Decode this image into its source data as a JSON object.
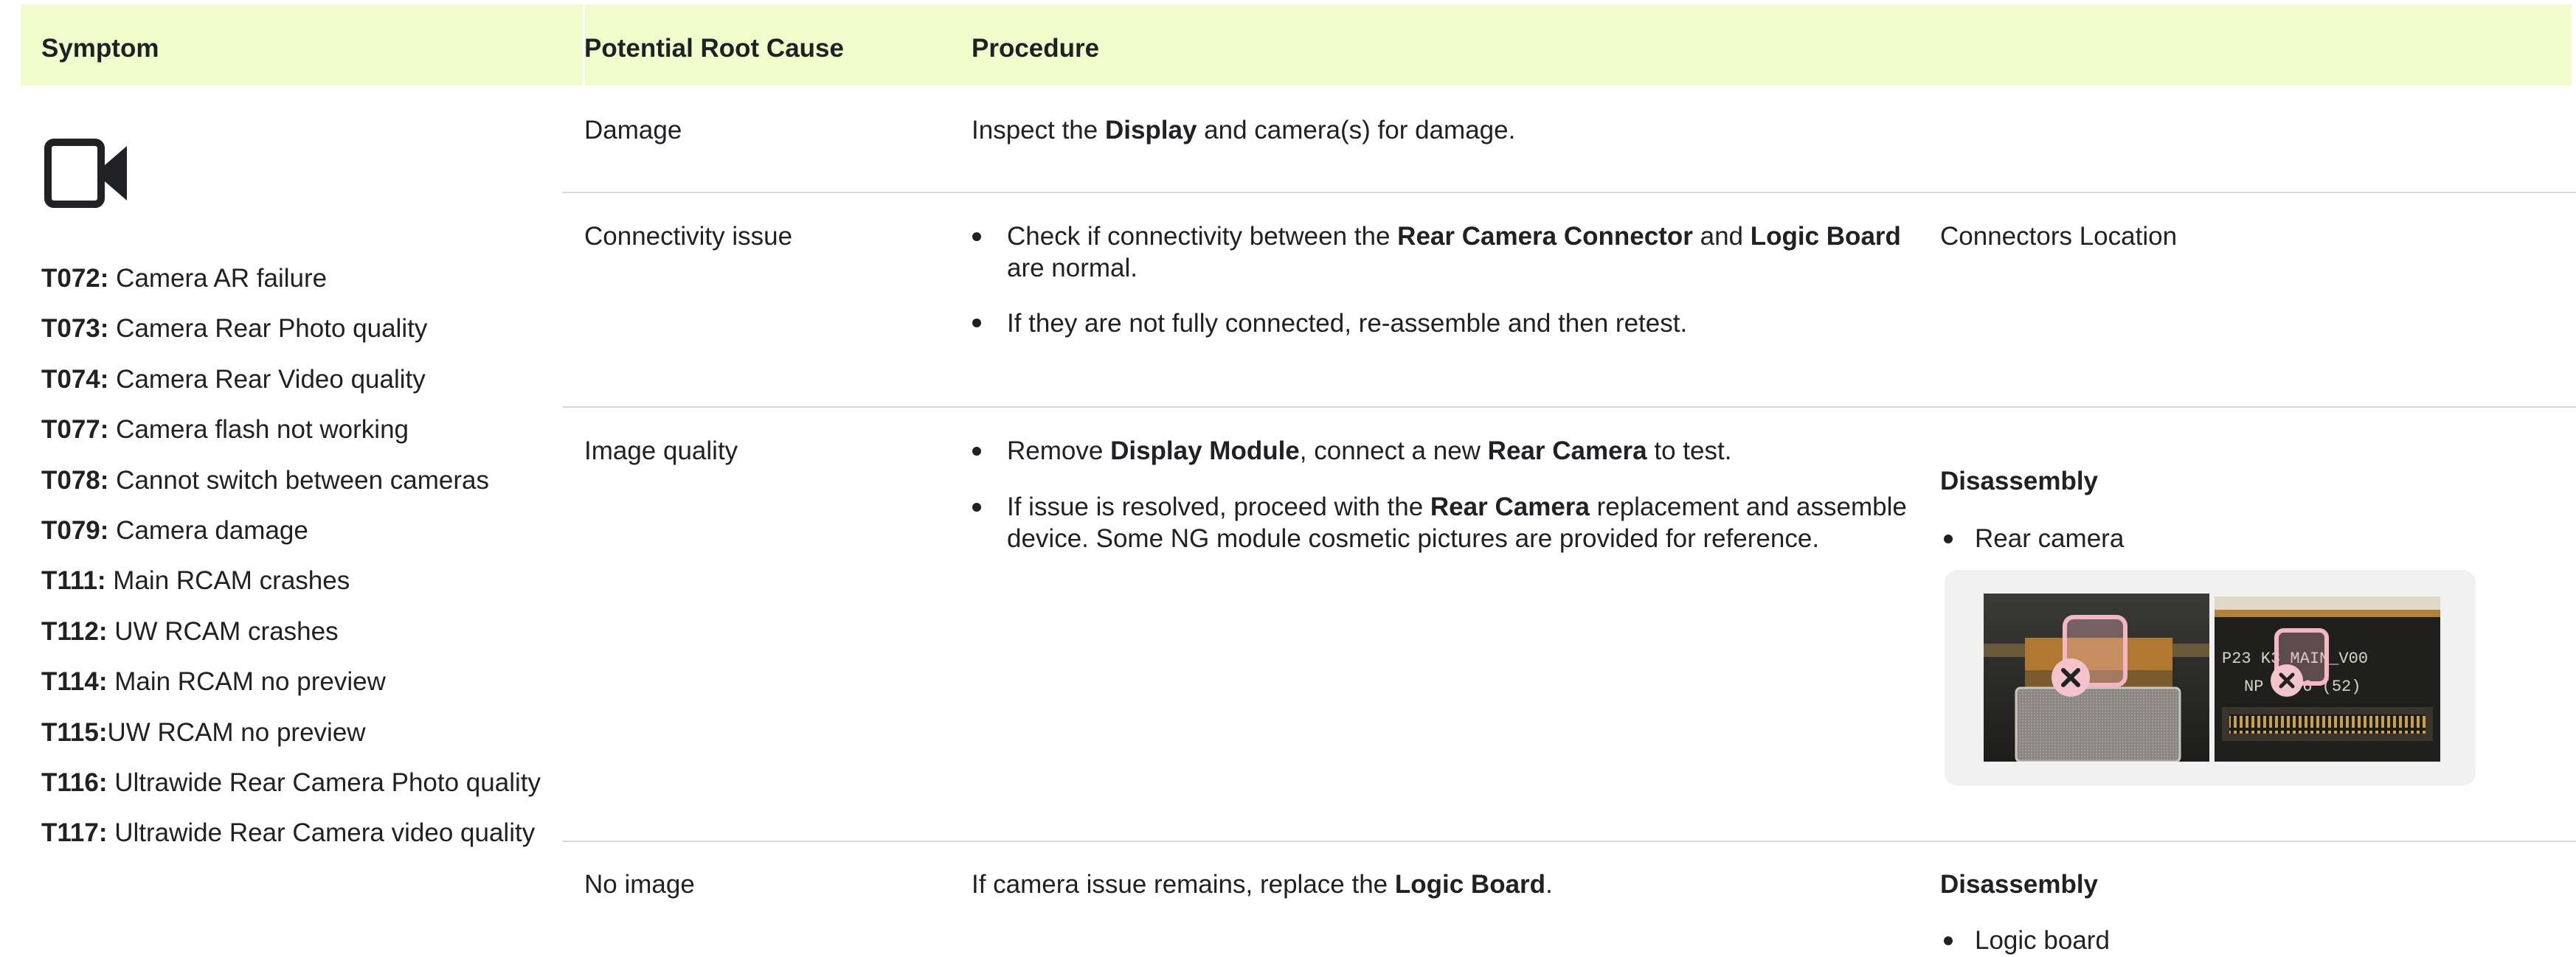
{
  "table": {
    "headers": {
      "symptom": "Symptom",
      "root_cause": "Potential Root Cause",
      "procedure": "Procedure"
    },
    "symptom_icon": "video-camera-icon",
    "symptoms": [
      {
        "code": "T072:",
        "text": " Camera AR failure"
      },
      {
        "code": "T073:",
        "text": " Camera Rear Photo quality"
      },
      {
        "code": "T074:",
        "text": " Camera Rear Video quality"
      },
      {
        "code": "T077:",
        "text": " Camera flash not working"
      },
      {
        "code": "T078:",
        "text": " Cannot switch between cameras"
      },
      {
        "code": "T079:",
        "text": " Camera damage"
      },
      {
        "code": "T111:",
        "text": " Main RCAM crashes"
      },
      {
        "code": "T112:",
        "text": " UW RCAM crashes"
      },
      {
        "code": "T114:",
        "text": " Main RCAM no preview"
      },
      {
        "code": "T115:",
        "text": "UW RCAM no preview"
      },
      {
        "code": "T116:",
        "text": " Ultrawide Rear Camera Photo quality"
      },
      {
        "code": "T117:",
        "text": " Ultrawide Rear Camera video quality"
      }
    ],
    "rows": {
      "damage": {
        "cause": "Damage",
        "p1": "Inspect the ",
        "p2": "Display",
        "p3": " and camera(s) for damage."
      },
      "connectivity": {
        "cause": "Connectivity issue",
        "b1_1": "Check if connectivity between the ",
        "b1_2": "Rear Camera Connector",
        "b1_3": " and ",
        "b1_4": "Logic Board",
        "b1_line2": "are normal.",
        "b2": "If they are not fully connected, re-assemble and then retest.",
        "extra": "Connectors Location"
      },
      "image_quality": {
        "cause": "Image quality",
        "b1_1": "Remove ",
        "b1_2": "Display Module",
        "b1_3": ", connect a new ",
        "b1_4": "Rear Camera",
        "b1_5": " to test.",
        "b2_1": "If issue is resolved, proceed with the ",
        "b2_2": "Rear Camera",
        "b2_3": " replacement and assemble",
        "b2_line2": "device. Some NG module cosmetic pictures are provided for reference.",
        "extra_title": "Disassembly",
        "extra_item": "Rear camera",
        "photo2_text1": "P23 K3 MAIN_V00",
        "photo2_text2": "NP 20 6 (52)"
      },
      "no_image": {
        "cause": "No image",
        "p1": "If camera issue remains, replace the ",
        "p2": "Logic Board",
        "p3": ".",
        "extra_title": "Disassembly",
        "extra_item": "Logic board"
      }
    }
  }
}
